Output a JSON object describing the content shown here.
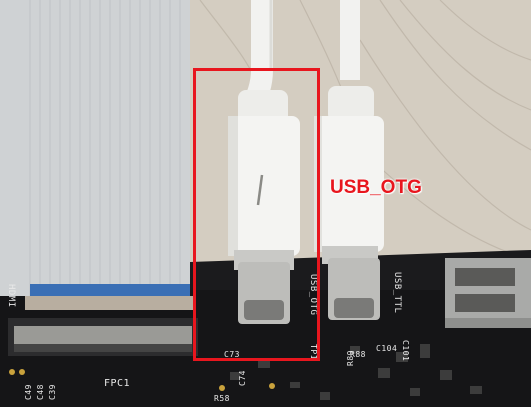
{
  "annotation": {
    "label": "USB_OTG",
    "color": "#e8161e"
  },
  "board": {
    "silkscreen": {
      "hdmi": "HDMI",
      "fpc": "FPC1",
      "usb_otg": "USB_OTG",
      "usb_ttl": "USB_TTL",
      "c39": "C39",
      "c48": "C48",
      "c49": "C49",
      "c73": "C73",
      "c74": "C74",
      "tp1": "TP1",
      "r58": "R58",
      "r88": "R88",
      "r89": "R89",
      "c104": "C104",
      "c101": "C101"
    }
  },
  "colors": {
    "pcb": "#1b1b1d",
    "cable": "#f4f4f2",
    "ribbon": "#cfd2d4",
    "ribbon_stripe": "#3a6fb5",
    "wood": "#d4cdc1"
  }
}
